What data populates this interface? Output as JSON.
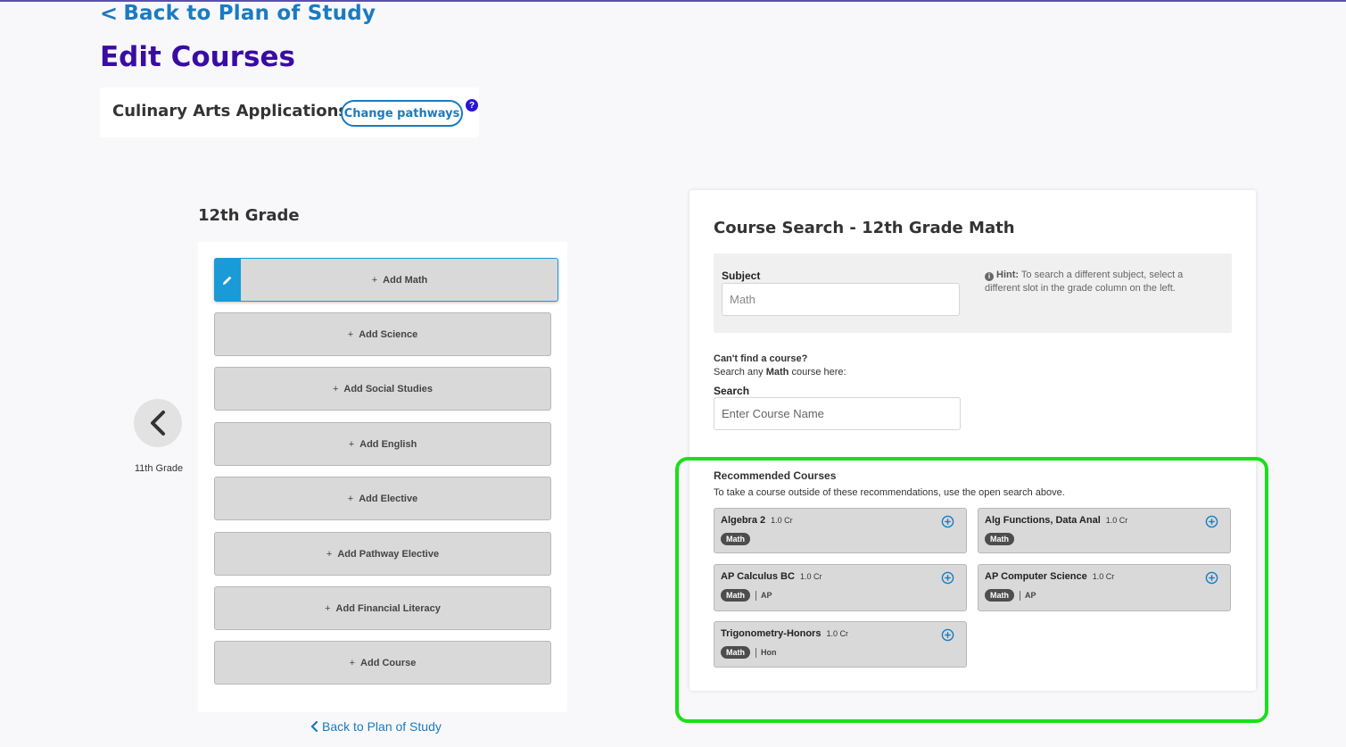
{
  "nav": {
    "back_label": "Back to Plan of Study",
    "page_title": "Edit Courses"
  },
  "pathway": {
    "name": "Culinary Arts Applications",
    "change_label": "Change pathways",
    "help_glyph": "?"
  },
  "grade": {
    "title": "12th Grade",
    "prev_label": "11th Grade",
    "slots": [
      {
        "label": "Add Math"
      },
      {
        "label": "Add Science"
      },
      {
        "label": "Add Social Studies"
      },
      {
        "label": "Add English"
      },
      {
        "label": "Add Elective"
      },
      {
        "label": "Add Pathway Elective"
      },
      {
        "label": "Add Financial Literacy"
      },
      {
        "label": "Add Course"
      }
    ],
    "back_bottom_label": "Back to Plan of Study"
  },
  "search_panel": {
    "title": "Course Search - 12th Grade Math",
    "subject_label": "Subject",
    "subject_value": "Math",
    "hint_prefix": "Hint:",
    "hint_text": "To search a different subject, select a different slot in the grade column on the left.",
    "cant_find": "Can't find a course?",
    "search_any_prefix": "Search any",
    "search_any_subject": "Math",
    "search_any_suffix": "course here:",
    "search_label": "Search",
    "search_placeholder": "Enter Course Name"
  },
  "recommended": {
    "title": "Recommended Courses",
    "subtitle": "To take a course outside of these recommendations, use the open search above.",
    "courses": [
      {
        "name": "Algebra 2",
        "credit": "1.0 Cr",
        "tag": "Math",
        "extra": ""
      },
      {
        "name": "Alg Functions, Data Anal",
        "credit": "1.0 Cr",
        "tag": "Math",
        "extra": ""
      },
      {
        "name": "AP Calculus BC",
        "credit": "1.0 Cr",
        "tag": "Math",
        "extra": "AP"
      },
      {
        "name": "AP Computer Science",
        "credit": "1.0 Cr",
        "tag": "Math",
        "extra": "AP"
      },
      {
        "name": "Trigonometry-Honors",
        "credit": "1.0 Cr",
        "tag": "Math",
        "extra": "Hon"
      }
    ]
  },
  "colors": {
    "link": "#1a7bbf",
    "title": "#3a0ca3",
    "active_slot": "#1a9ad6",
    "highlight": "#19e019"
  },
  "icons": {
    "back": "chevron-left-icon",
    "edit": "pencil-icon",
    "add": "plus-circle-icon",
    "info": "info-icon"
  }
}
